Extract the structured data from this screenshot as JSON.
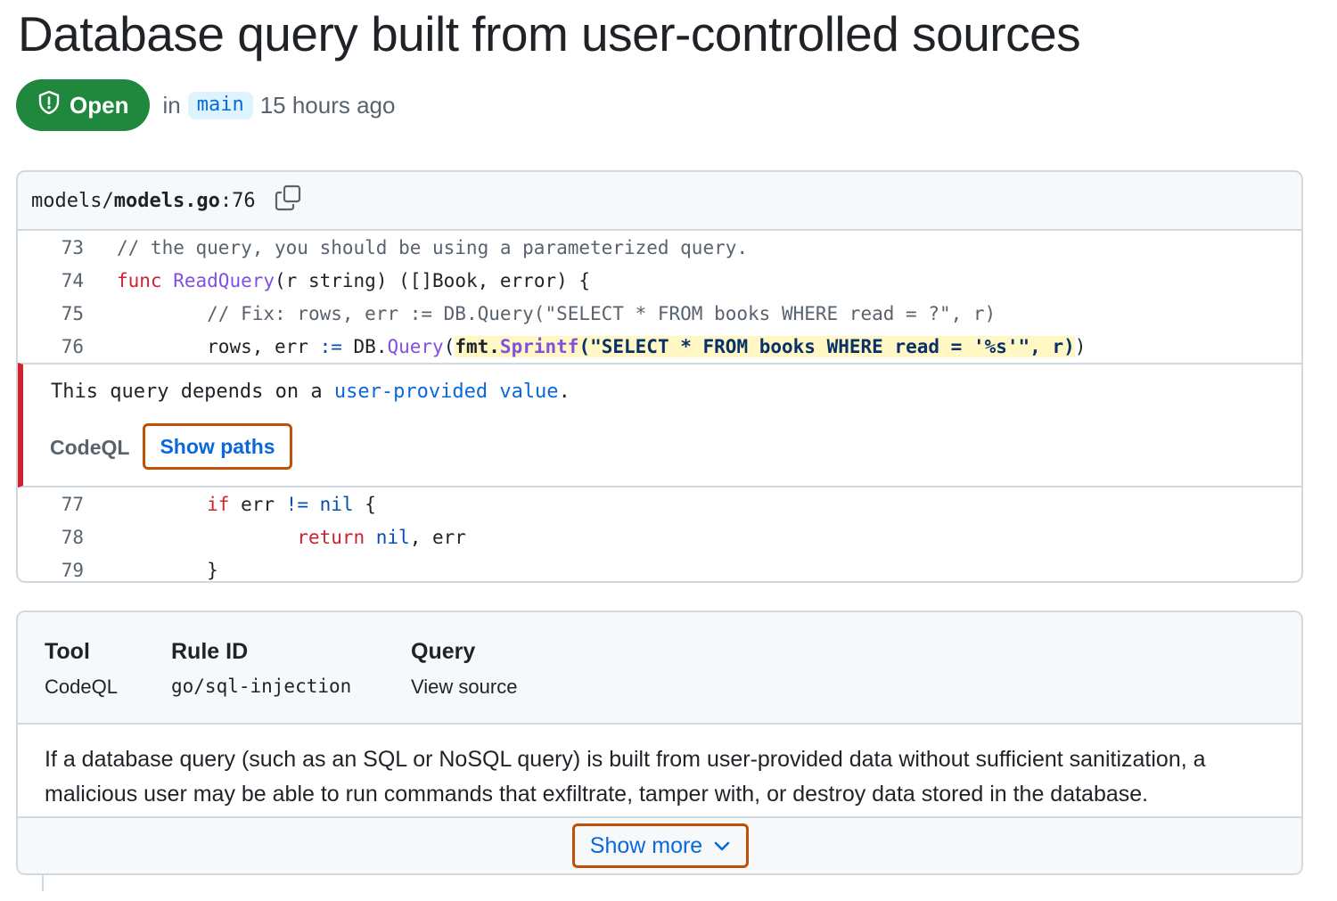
{
  "alert": {
    "title": "Database query built from user-controlled sources",
    "status_label": "Open",
    "status_icon": "shield-alert-icon",
    "in_label": "in",
    "branch": "main",
    "time_ago": "15 hours ago"
  },
  "file": {
    "path_prefix": "models/",
    "file_name": "models.go",
    "line_suffix": ":76",
    "copy_icon": "copy-icon"
  },
  "code": {
    "line_73": {
      "num": "73",
      "text": "// the query, you should be using a parameterized query."
    },
    "line_74": {
      "num": "74",
      "kw": "func",
      "fn": "ReadQuery",
      "rest": "(r string) ([]Book, error) {"
    },
    "line_75": {
      "num": "75",
      "indent": "        ",
      "text": "// Fix: rows, err := DB.Query(\"SELECT * FROM books WHERE read = ?\", r)"
    },
    "line_76": {
      "num": "76",
      "indent": "        ",
      "pre": "rows, err ",
      "op": ":=",
      "mid": " DB.",
      "fn": "Query",
      "open": "(",
      "hl_pkg": "fmt.",
      "hl_fn": "Sprintf",
      "hl_str": "(\"SELECT * FROM books WHERE read = '%s'\", r)",
      "close": ")"
    },
    "line_77": {
      "num": "77",
      "indent": "        ",
      "kw": "if",
      "mid": " err ",
      "op": "!=",
      "cst": " nil",
      "rest": " {"
    },
    "line_78": {
      "num": "78",
      "indent": "                ",
      "kw": "return",
      "cst": " nil",
      "rest": ", err"
    },
    "line_79": {
      "num": "79",
      "indent": "        ",
      "text": "}"
    }
  },
  "alert_message": {
    "text_before": "This query depends on a ",
    "link_text": "user-provided value",
    "text_after": ".",
    "tool": "CodeQL",
    "show_paths_label": "Show paths"
  },
  "details": {
    "tool_header": "Tool",
    "tool_value": "CodeQL",
    "rule_header": "Rule ID",
    "rule_value": "go/sql-injection",
    "query_header": "Query",
    "query_value": "View source",
    "description": "If a database query (such as an SQL or NoSQL query) is built from user-provided data without sufficient sanitization, a malicious user may be able to run commands that exfiltrate, tamper with, or destroy data stored in the database.",
    "show_more_label": "Show more",
    "show_more_icon": "chevron-down-icon"
  },
  "colors": {
    "open_green": "#1f883d",
    "alert_red": "#cf222e",
    "link_blue": "#0969da",
    "highlight_yellow": "#fff8c5",
    "focus_orange": "#bf5106"
  }
}
